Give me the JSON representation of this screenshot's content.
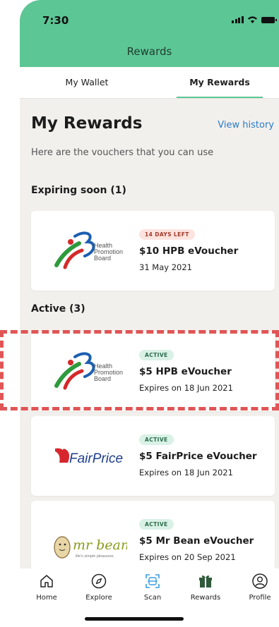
{
  "status_bar": {
    "time": "7:30"
  },
  "header": {
    "title": "Rewards"
  },
  "tabs": [
    {
      "label": "My Wallet"
    },
    {
      "label": "My Rewards"
    }
  ],
  "page": {
    "heading": "My Rewards",
    "view_history": "View history",
    "subtitle": "Here are the vouchers that you can use"
  },
  "sections": {
    "expiring": "Expiring soon (1)",
    "active": "Active (3)"
  },
  "vouchers": {
    "expiring": [
      {
        "badge": "14 DAYS LEFT",
        "title": "$10 HPB eVoucher",
        "date": "31 May 2021",
        "logo_text": [
          "Health",
          "Promotion",
          "Board"
        ]
      }
    ],
    "active": [
      {
        "badge": "ACTIVE",
        "title": "$5 HPB eVoucher",
        "date": "Expires on 18 Jun 2021",
        "logo_text": [
          "Health",
          "Promotion",
          "Board"
        ]
      },
      {
        "badge": "ACTIVE",
        "title": "$5 FairPrice eVoucher",
        "date": "Expires on 18 Jun 2021",
        "logo_text": "FairPrice"
      },
      {
        "badge": "ACTIVE",
        "title": "$5 Mr Bean eVoucher",
        "date": "Expires on 20 Sep 2021",
        "logo_text": [
          "mr bean",
          "life's simple pleasures"
        ]
      }
    ]
  },
  "nav": [
    {
      "label": "Home",
      "icon": "home-icon"
    },
    {
      "label": "Explore",
      "icon": "compass-icon"
    },
    {
      "label": "Scan",
      "icon": "scan-icon"
    },
    {
      "label": "Rewards",
      "icon": "gift-icon"
    },
    {
      "label": "Profile",
      "icon": "profile-icon"
    }
  ],
  "colors": {
    "brand_green": "#5cc695",
    "link_blue": "#2a7ac9",
    "highlight_red": "#e05555"
  }
}
